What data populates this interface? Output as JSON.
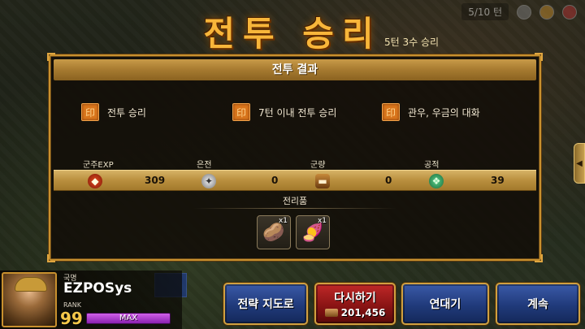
{
  "hud": {
    "turn": "5/10 턴"
  },
  "title": "전투 승리",
  "subtitle": "5턴 3수 승리",
  "panel": {
    "header": "전투 결과",
    "conditions": [
      {
        "icon": "seal-icon",
        "label": "전투 승리"
      },
      {
        "icon": "seal-icon",
        "label": "7턴 이내 전투 승리"
      },
      {
        "icon": "seal-icon",
        "label": "관우, 우금의 대화"
      }
    ],
    "rewards": [
      {
        "label": "군주EXP",
        "icon": "exp-icon",
        "value": "309"
      },
      {
        "label": "은전",
        "icon": "silver-coin-icon",
        "value": "0"
      },
      {
        "label": "군량",
        "icon": "food-icon",
        "value": "0"
      },
      {
        "label": "공적",
        "icon": "merit-icon",
        "value": "39"
      }
    ],
    "loot_label": "전리품",
    "loot": [
      {
        "icon": "potato-sack-icon",
        "count": "x1"
      },
      {
        "icon": "sweet-potato-icon",
        "count": "x1"
      }
    ]
  },
  "player": {
    "nation_label": "국명",
    "name": "EZPOSys",
    "rank_label": "RANK",
    "rank": "99",
    "bar_text": "MAX"
  },
  "buttons": {
    "strategy_map": "전략 지도로",
    "retry": "다시하기",
    "retry_cost": "201,456",
    "chronicle": "연대기",
    "continue": "계속"
  }
}
